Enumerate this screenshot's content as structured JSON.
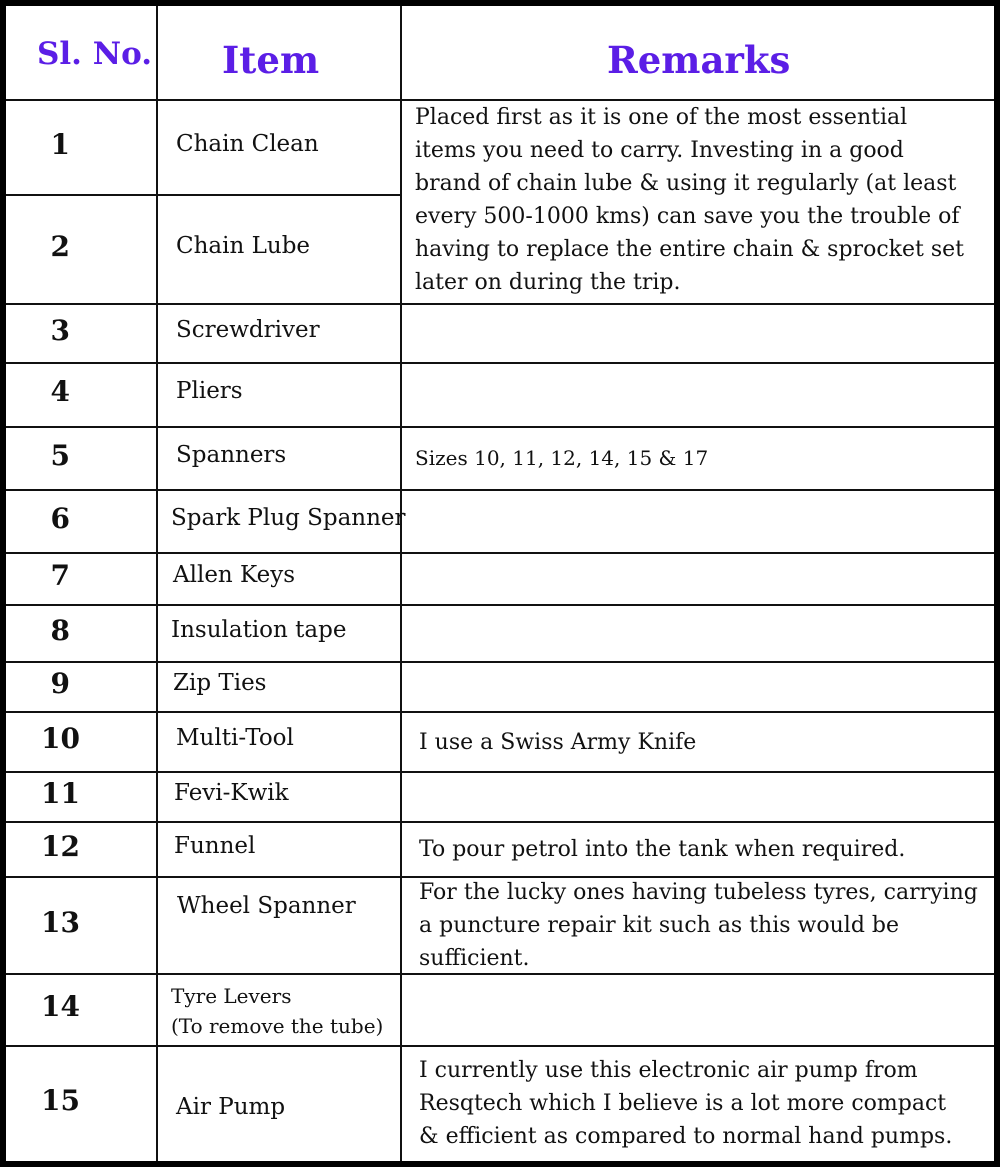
{
  "table": {
    "headers": {
      "sl_no": "Sl. No.",
      "item": "Item",
      "remarks": "Remarks"
    },
    "header_color": "#5b1ee6",
    "rows": [
      {
        "no": "1",
        "item": "Chain Clean"
      },
      {
        "no": "2",
        "item": "Chain Lube"
      },
      {
        "no": "3",
        "item": "Screwdriver",
        "remarks": ""
      },
      {
        "no": "4",
        "item": "Pliers",
        "remarks": ""
      },
      {
        "no": "5",
        "item": "Spanners",
        "remarks": "Sizes 10, 11, 12, 14, 15 & 17"
      },
      {
        "no": "6",
        "item": "Spark Plug Spanner",
        "remarks": ""
      },
      {
        "no": "7",
        "item": "Allen Keys",
        "remarks": ""
      },
      {
        "no": "8",
        "item": "Insulation tape",
        "remarks": ""
      },
      {
        "no": "9",
        "item": "Zip Ties",
        "remarks": ""
      },
      {
        "no": "10",
        "item": "Multi-Tool",
        "remarks": "I use a Swiss Army Knife"
      },
      {
        "no": "11",
        "item": "Fevi-Kwik",
        "remarks": ""
      },
      {
        "no": "12",
        "item": "Funnel",
        "remarks": "To pour petrol into the tank when required."
      },
      {
        "no": "13",
        "item": "Wheel Spanner",
        "remarks": "For the lucky ones having tubeless tyres, carrying\na puncture repair kit such as this would be\nsufficient."
      },
      {
        "no": "14",
        "item": "Tyre Levers",
        "item_note": "(To remove the tube)",
        "remarks": ""
      },
      {
        "no": "15",
        "item": "Air Pump",
        "remarks": "I currently use this electronic air pump from\nResqtech which I believe is a lot more compact\n& efficient as compared to normal hand pumps."
      }
    ],
    "merged_remarks_1_2": "Placed first as it is one of the most essential\nitems you need to carry. Investing in a good\nbrand of chain lube & using it regularly (at least\nevery 500-1000 kms) can save you the trouble of\nhaving to replace the entire chain & sprocket set\nlater on during the trip."
  }
}
